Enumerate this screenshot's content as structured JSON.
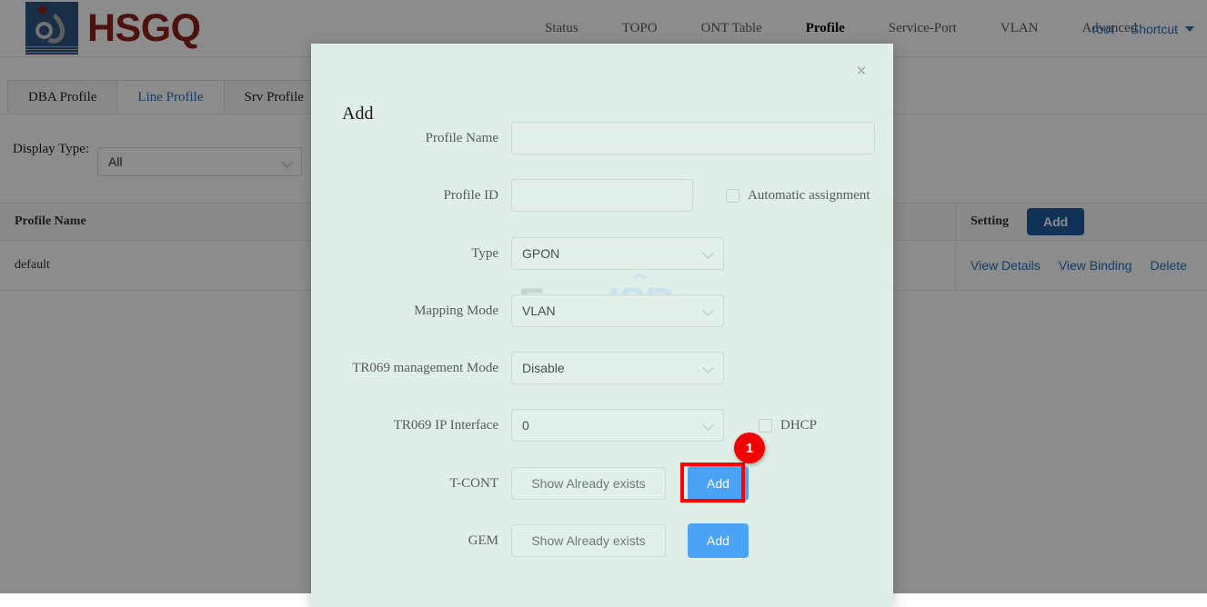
{
  "brand": {
    "name": "HSGQ",
    "logo_icon": "hsgq-logo-icon"
  },
  "nav": {
    "items": [
      {
        "label": "Status",
        "active": false
      },
      {
        "label": "TOPO",
        "active": false
      },
      {
        "label": "ONT Table",
        "active": false
      },
      {
        "label": "Profile",
        "active": true
      },
      {
        "label": "Service-Port",
        "active": false
      },
      {
        "label": "VLAN",
        "active": false
      },
      {
        "label": "Advanced",
        "active": false
      }
    ],
    "user": "root",
    "shortcut": "Shortcut"
  },
  "tabs": [
    {
      "label": "DBA Profile",
      "active": false
    },
    {
      "label": "Line Profile",
      "active": true
    },
    {
      "label": "Srv Profile",
      "active": false
    }
  ],
  "filter": {
    "label": "Display Type:",
    "display_type_value": "All"
  },
  "table": {
    "headers": [
      "Profile Name",
      "Setting"
    ],
    "add_label": "Add",
    "rows": [
      {
        "profile_name": "default",
        "actions": [
          "View Details",
          "View Binding",
          "Delete"
        ]
      }
    ]
  },
  "modal": {
    "title": "Add",
    "close_label": "×",
    "fields": {
      "profile_name": {
        "label": "Profile Name",
        "value": "",
        "placeholder": ""
      },
      "profile_id": {
        "label": "Profile ID",
        "value": "",
        "placeholder": ""
      },
      "automatic_assignment": {
        "label": "Automatic assignment",
        "checked": false
      },
      "type": {
        "label": "Type",
        "value": "GPON"
      },
      "mapping_mode": {
        "label": "Mapping Mode",
        "value": "VLAN"
      },
      "tr069_management_mode": {
        "label": "TR069 management Mode",
        "value": "Disable"
      },
      "tr069_ip_interface": {
        "label": "TR069 IP Interface",
        "value": "0"
      },
      "dhcp": {
        "label": "DHCP",
        "checked": false
      },
      "tcont": {
        "label": "T-CONT",
        "show_label": "Show Already exists",
        "add_label": "Add"
      },
      "gem": {
        "label": "GEM",
        "show_label": "Show Already exists",
        "add_label": "Add"
      }
    }
  },
  "watermark": {
    "part1": "Foro",
    "part2": "ISP"
  },
  "annotation": {
    "badge": "1"
  },
  "colors": {
    "brand_red": "#8c2118",
    "logo_blue": "#2e5481",
    "link_blue": "#2a6ebb",
    "primary_blue": "#4aa3f5",
    "table_add_blue": "#1f5c9e",
    "modal_bg": "#dfeee6",
    "highlight_red": "#ff0000"
  }
}
